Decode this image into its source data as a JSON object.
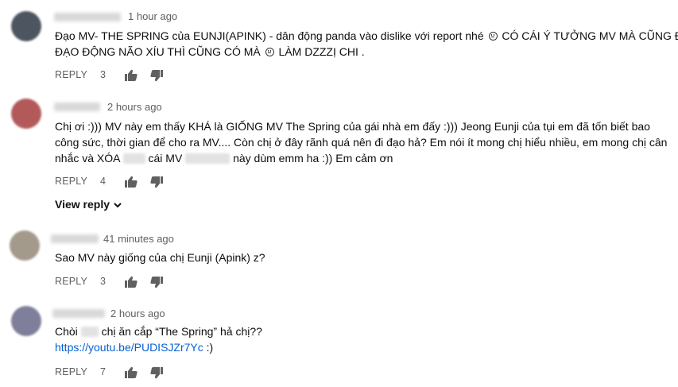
{
  "comments": [
    {
      "time": "1 hour ago",
      "lines": [
        {
          "before_emoji": "Đạo MV- THE SPRING của EUNJI(APINK) - dân động panda vào dislike với report nhé",
          "after_emoji": "CÓ CÁI Ý TƯỞNG MV MÀ CŨNG ĐI"
        },
        {
          "before_emoji": "ĐẠO ĐỘNG NÃO XÍU THÌ CŨNG CÓ MÀ",
          "after_emoji": "LÀM DZZZỊ CHI ."
        }
      ],
      "emoji_icons": [
        "neutral-face-icon",
        "expressionless-face-icon"
      ],
      "reply_label": "REPLY",
      "like_count": "3"
    },
    {
      "time": "2 hours ago",
      "lines": [
        "Chị ơi :))) MV này em thấy KHÁ là GIỐNG MV The Spring của gái nhà em đấy :))) Jeong Eunji của tụi em đã tốn biết bao",
        "công sức, thời gian để cho ra MV.... Còn chị ở đây rãnh quá nên đi đạo hả?  Em nói ít mong chị hiểu nhiều, em mong chị cân"
      ],
      "line3_a": "nhắc và XÓA",
      "line3_b": "cái MV",
      "line3_c": "này dùm emm ha :)) Em cảm ơn",
      "reply_label": "REPLY",
      "like_count": "4",
      "view_reply_label": "View reply"
    },
    {
      "time": "41 minutes ago",
      "text": "Sao MV này giống của chị Eunji   (Apink) z?",
      "reply_label": "REPLY",
      "like_count": "3"
    },
    {
      "time": "2 hours ago",
      "line1_a": "Chòi",
      "line1_b": "chị ăn cắp “The Spring” hả chị??",
      "link": "https://youtu.be/PUDISJZr7Yc",
      "link_suffix": " :)",
      "reply_label": "REPLY",
      "like_count": "7"
    }
  ],
  "icons": {
    "like": "thumbs-up-icon",
    "dislike": "thumbs-down-icon",
    "chevron": "chevron-down-icon"
  },
  "colors": {
    "link": "#065fd4",
    "meta": "#606060",
    "text": "#0d0d0d"
  }
}
